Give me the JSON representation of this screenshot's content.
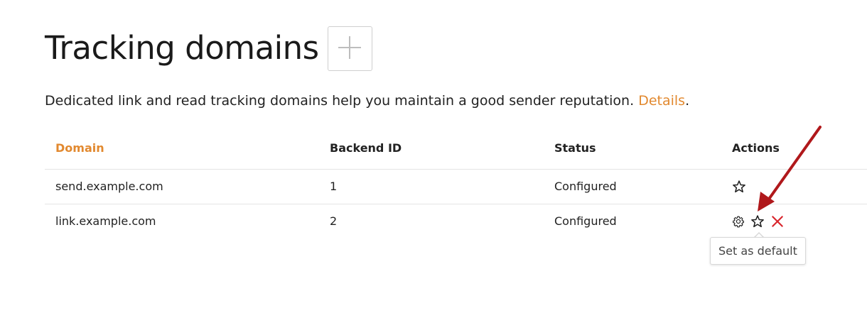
{
  "page": {
    "title": "Tracking domains",
    "add_button_icon": "plus-icon"
  },
  "intro": {
    "text": "Dedicated link and read tracking domains help you maintain a good sender reputation. ",
    "link_label": "Details",
    "trailing": "."
  },
  "table": {
    "columns": {
      "domain": "Domain",
      "backend_id": "Backend ID",
      "status": "Status",
      "actions": "Actions"
    },
    "rows": [
      {
        "domain": "send.example.com",
        "backend_id": "1",
        "status": "Configured",
        "actions": [
          "star-icon"
        ]
      },
      {
        "domain": "link.example.com",
        "backend_id": "2",
        "status": "Configured",
        "actions": [
          "gear-icon",
          "star-icon",
          "delete-x-icon"
        ]
      }
    ]
  },
  "tooltip": {
    "text": "Set as default"
  },
  "colors": {
    "accent": "#e2892f",
    "delete": "#d9262d",
    "annotation_arrow": "#b0181b",
    "border": "#e4e4e4"
  }
}
